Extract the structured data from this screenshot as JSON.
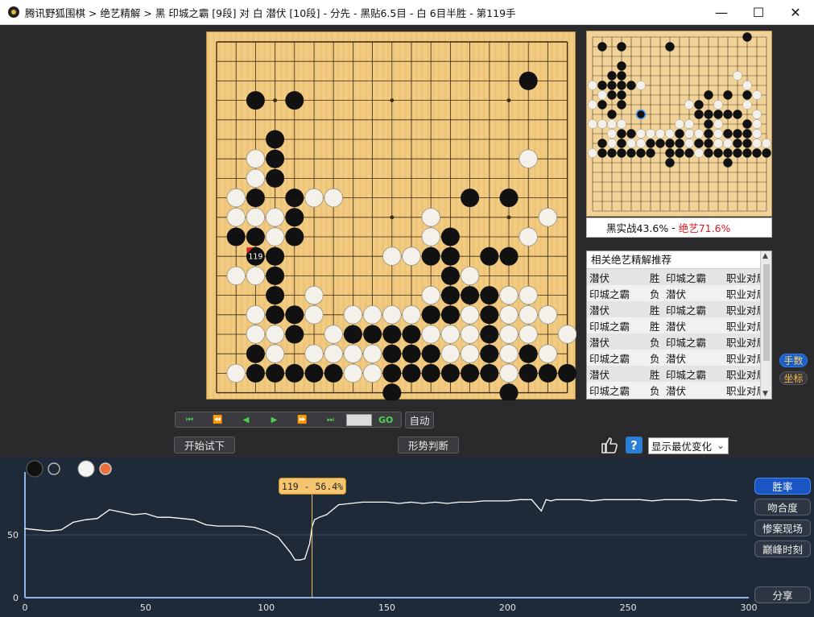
{
  "window": {
    "title": "腾讯野狐围棋 > 绝艺精解 > 黑 印城之霸 [9段] 对 白 潜伏 [10段] - 分先 - 黑贴6.5目 - 白 6目半胜 - 第119手",
    "controls": {
      "minimize": "—",
      "maximize": "☐",
      "close": "✕"
    }
  },
  "board": {
    "size": 19,
    "last_move_number": "119",
    "black": [
      [
        2,
        3
      ],
      [
        4,
        3
      ],
      [
        16,
        2
      ],
      [
        3,
        5
      ],
      [
        3,
        6
      ],
      [
        3,
        7
      ],
      [
        2,
        8
      ],
      [
        4,
        8
      ],
      [
        4,
        9
      ],
      [
        1,
        10
      ],
      [
        2,
        10
      ],
      [
        4,
        10
      ],
      [
        3,
        11
      ],
      [
        13,
        8
      ],
      [
        15,
        8
      ],
      [
        3,
        12
      ],
      [
        3,
        13
      ],
      [
        12,
        10
      ],
      [
        12,
        11
      ],
      [
        11,
        11
      ],
      [
        14,
        11
      ],
      [
        15,
        11
      ],
      [
        12,
        12
      ],
      [
        12,
        13
      ],
      [
        13,
        13
      ],
      [
        14,
        13
      ],
      [
        3,
        14
      ],
      [
        4,
        14
      ],
      [
        11,
        14
      ],
      [
        12,
        14
      ],
      [
        14,
        14
      ],
      [
        4,
        15
      ],
      [
        7,
        15
      ],
      [
        8,
        15
      ],
      [
        9,
        15
      ],
      [
        10,
        15
      ],
      [
        14,
        15
      ],
      [
        2,
        16
      ],
      [
        9,
        16
      ],
      [
        10,
        16
      ],
      [
        11,
        16
      ],
      [
        14,
        16
      ],
      [
        16,
        16
      ],
      [
        2,
        17
      ],
      [
        3,
        17
      ],
      [
        4,
        17
      ],
      [
        5,
        17
      ],
      [
        6,
        17
      ],
      [
        9,
        17
      ],
      [
        10,
        17
      ],
      [
        11,
        17
      ],
      [
        12,
        17
      ],
      [
        13,
        17
      ],
      [
        14,
        17
      ],
      [
        16,
        17
      ],
      [
        17,
        17
      ],
      [
        18,
        17
      ],
      [
        9,
        18
      ],
      [
        15,
        18
      ]
    ],
    "white": [
      [
        2,
        6
      ],
      [
        2,
        7
      ],
      [
        1,
        8
      ],
      [
        5,
        8
      ],
      [
        6,
        8
      ],
      [
        1,
        9
      ],
      [
        2,
        9
      ],
      [
        3,
        9
      ],
      [
        3,
        10
      ],
      [
        16,
        6
      ],
      [
        17,
        9
      ],
      [
        11,
        9
      ],
      [
        11,
        10
      ],
      [
        16,
        10
      ],
      [
        9,
        11
      ],
      [
        10,
        11
      ],
      [
        13,
        12
      ],
      [
        1,
        12
      ],
      [
        2,
        12
      ],
      [
        5,
        13
      ],
      [
        11,
        13
      ],
      [
        15,
        13
      ],
      [
        16,
        13
      ],
      [
        2,
        14
      ],
      [
        5,
        14
      ],
      [
        7,
        14
      ],
      [
        8,
        14
      ],
      [
        9,
        14
      ],
      [
        10,
        14
      ],
      [
        13,
        14
      ],
      [
        15,
        14
      ],
      [
        16,
        14
      ],
      [
        17,
        14
      ],
      [
        2,
        15
      ],
      [
        3,
        15
      ],
      [
        6,
        15
      ],
      [
        11,
        15
      ],
      [
        12,
        15
      ],
      [
        13,
        15
      ],
      [
        15,
        15
      ],
      [
        16,
        15
      ],
      [
        18,
        15
      ],
      [
        3,
        16
      ],
      [
        5,
        16
      ],
      [
        6,
        16
      ],
      [
        7,
        16
      ],
      [
        8,
        16
      ],
      [
        12,
        16
      ],
      [
        13,
        16
      ],
      [
        15,
        16
      ],
      [
        17,
        16
      ],
      [
        1,
        17
      ],
      [
        7,
        17
      ],
      [
        8,
        17
      ],
      [
        15,
        17
      ]
    ],
    "last_move": [
      2,
      11
    ]
  },
  "mini_board": {
    "size": 19,
    "black": [
      [
        1,
        1
      ],
      [
        3,
        1
      ],
      [
        8,
        1
      ],
      [
        16,
        0
      ],
      [
        3,
        3
      ],
      [
        2,
        4
      ],
      [
        3,
        4
      ],
      [
        1,
        5
      ],
      [
        2,
        5
      ],
      [
        3,
        5
      ],
      [
        4,
        5
      ],
      [
        2,
        6
      ],
      [
        3,
        6
      ],
      [
        1,
        7
      ],
      [
        3,
        7
      ],
      [
        2,
        8
      ],
      [
        12,
        6
      ],
      [
        14,
        6
      ],
      [
        16,
        6
      ],
      [
        11,
        7
      ],
      [
        12,
        8
      ],
      [
        11,
        8
      ],
      [
        13,
        8
      ],
      [
        14,
        8
      ],
      [
        15,
        8
      ],
      [
        12,
        9
      ],
      [
        16,
        9
      ],
      [
        3,
        10
      ],
      [
        4,
        10
      ],
      [
        9,
        10
      ],
      [
        12,
        10
      ],
      [
        14,
        10
      ],
      [
        15,
        10
      ],
      [
        16,
        10
      ],
      [
        3,
        11
      ],
      [
        6,
        11
      ],
      [
        7,
        11
      ],
      [
        8,
        11
      ],
      [
        9,
        11
      ],
      [
        11,
        11
      ],
      [
        12,
        11
      ],
      [
        15,
        11
      ],
      [
        16,
        11
      ],
      [
        1,
        12
      ],
      [
        2,
        12
      ],
      [
        3,
        12
      ],
      [
        4,
        12
      ],
      [
        5,
        12
      ],
      [
        6,
        12
      ],
      [
        8,
        12
      ],
      [
        9,
        12
      ],
      [
        10,
        12
      ],
      [
        12,
        12
      ],
      [
        13,
        12
      ],
      [
        14,
        12
      ],
      [
        15,
        12
      ],
      [
        16,
        12
      ],
      [
        17,
        12
      ],
      [
        18,
        12
      ],
      [
        1,
        11
      ],
      [
        8,
        13
      ],
      [
        14,
        13
      ]
    ],
    "white": [
      [
        15,
        4
      ],
      [
        1,
        5
      ],
      [
        1,
        6
      ],
      [
        0,
        5
      ],
      [
        4,
        5
      ],
      [
        5,
        5
      ],
      [
        3,
        9
      ],
      [
        0,
        7
      ],
      [
        1,
        9
      ],
      [
        2,
        9
      ],
      [
        5,
        10
      ],
      [
        6,
        10
      ],
      [
        7,
        10
      ],
      [
        8,
        10
      ],
      [
        10,
        10
      ],
      [
        11,
        10
      ],
      [
        13,
        10
      ],
      [
        14,
        10
      ],
      [
        17,
        10
      ],
      [
        2,
        10
      ],
      [
        4,
        11
      ],
      [
        5,
        11
      ],
      [
        10,
        11
      ],
      [
        13,
        11
      ],
      [
        14,
        11
      ],
      [
        17,
        11
      ],
      [
        18,
        11
      ],
      [
        0,
        12
      ],
      [
        2,
        11
      ],
      [
        11,
        12
      ],
      [
        10,
        7
      ],
      [
        13,
        7
      ],
      [
        16,
        7
      ],
      [
        17,
        6
      ],
      [
        15,
        8
      ],
      [
        13,
        9
      ],
      [
        10,
        9
      ],
      [
        9,
        9
      ],
      [
        17,
        9
      ],
      [
        17,
        8
      ],
      [
        16,
        5
      ],
      [
        0,
        9
      ]
    ],
    "blue_marker": [
      5,
      8
    ]
  },
  "winrate": {
    "black_label": "黑实战43.6%",
    "separator": "-",
    "ai_label": "绝艺71.6%"
  },
  "recommend": {
    "header": "相关绝艺精解推荐",
    "rows": [
      {
        "a": "潜伏",
        "r": "胜",
        "b": "印城之霸",
        "t": "职业对局"
      },
      {
        "a": "印城之霸",
        "r": "负",
        "b": "潜伏",
        "t": "职业对局"
      },
      {
        "a": "潜伏",
        "r": "胜",
        "b": "印城之霸",
        "t": "职业对局"
      },
      {
        "a": "印城之霸",
        "r": "胜",
        "b": "潜伏",
        "t": "职业对局"
      },
      {
        "a": "潜伏",
        "r": "负",
        "b": "印城之霸",
        "t": "职业对局"
      },
      {
        "a": "印城之霸",
        "r": "负",
        "b": "潜伏",
        "t": "职业对局"
      },
      {
        "a": "潜伏",
        "r": "胜",
        "b": "印城之霸",
        "t": "职业对局"
      },
      {
        "a": "印城之霸",
        "r": "负",
        "b": "潜伏",
        "t": "职业对局"
      }
    ]
  },
  "side_buttons": {
    "moves": "手数",
    "coords": "坐标"
  },
  "navigation": {
    "first": "⏮",
    "back10": "⏪",
    "prev": "◀",
    "next": "▶",
    "fwd10": "⏩",
    "last": "⏭",
    "go": "GO",
    "auto": "自动",
    "try_play": "开始试下",
    "judge": "形势判断",
    "help": "?",
    "variation_select": "显示最优变化"
  },
  "chart_data": {
    "type": "line",
    "title": "",
    "xlabel": "",
    "ylabel": "",
    "xlim": [
      0,
      300
    ],
    "ylim": [
      0,
      100
    ],
    "x_ticks": [
      "0",
      "50",
      "100",
      "150",
      "200",
      "250",
      "300"
    ],
    "y_ticks": [
      "0",
      "50"
    ],
    "series": [
      {
        "name": "",
        "color": "#ffffff",
        "x": [
          0,
          5,
          10,
          15,
          20,
          25,
          30,
          35,
          40,
          45,
          50,
          55,
          60,
          65,
          70,
          75,
          80,
          85,
          90,
          95,
          100,
          105,
          110,
          112,
          114,
          116,
          118,
          119,
          120,
          122,
          125,
          130,
          135,
          140,
          145,
          150,
          155,
          160,
          165,
          170,
          175,
          180,
          185,
          190,
          195,
          200,
          205,
          210,
          214,
          216,
          218,
          220,
          225,
          230,
          235,
          240,
          245,
          250,
          255,
          260,
          265,
          270,
          275,
          280,
          285,
          290,
          295
        ],
        "y": [
          55,
          54,
          53,
          54,
          60,
          62,
          63,
          70,
          68,
          66,
          67,
          64,
          64,
          63,
          62,
          58,
          57,
          57,
          57,
          56,
          53,
          48,
          36,
          30,
          30,
          31,
          43,
          56.4,
          62,
          64,
          66,
          74,
          75,
          76,
          76,
          76,
          75,
          76,
          75,
          76,
          75,
          76,
          76,
          77,
          77,
          77,
          78,
          78,
          69,
          78,
          77,
          78,
          78,
          78,
          77,
          78,
          78,
          78,
          78,
          77,
          78,
          78,
          78,
          77,
          78,
          78,
          77
        ]
      }
    ],
    "marker": {
      "x": 119,
      "label": "119 - 56.4%"
    },
    "grid": true
  },
  "chart_controls": {
    "win_rate": "胜率",
    "match_rate": "吻合度",
    "disaster": "惨案现场",
    "peak": "巅峰时刻",
    "share": "分享"
  }
}
